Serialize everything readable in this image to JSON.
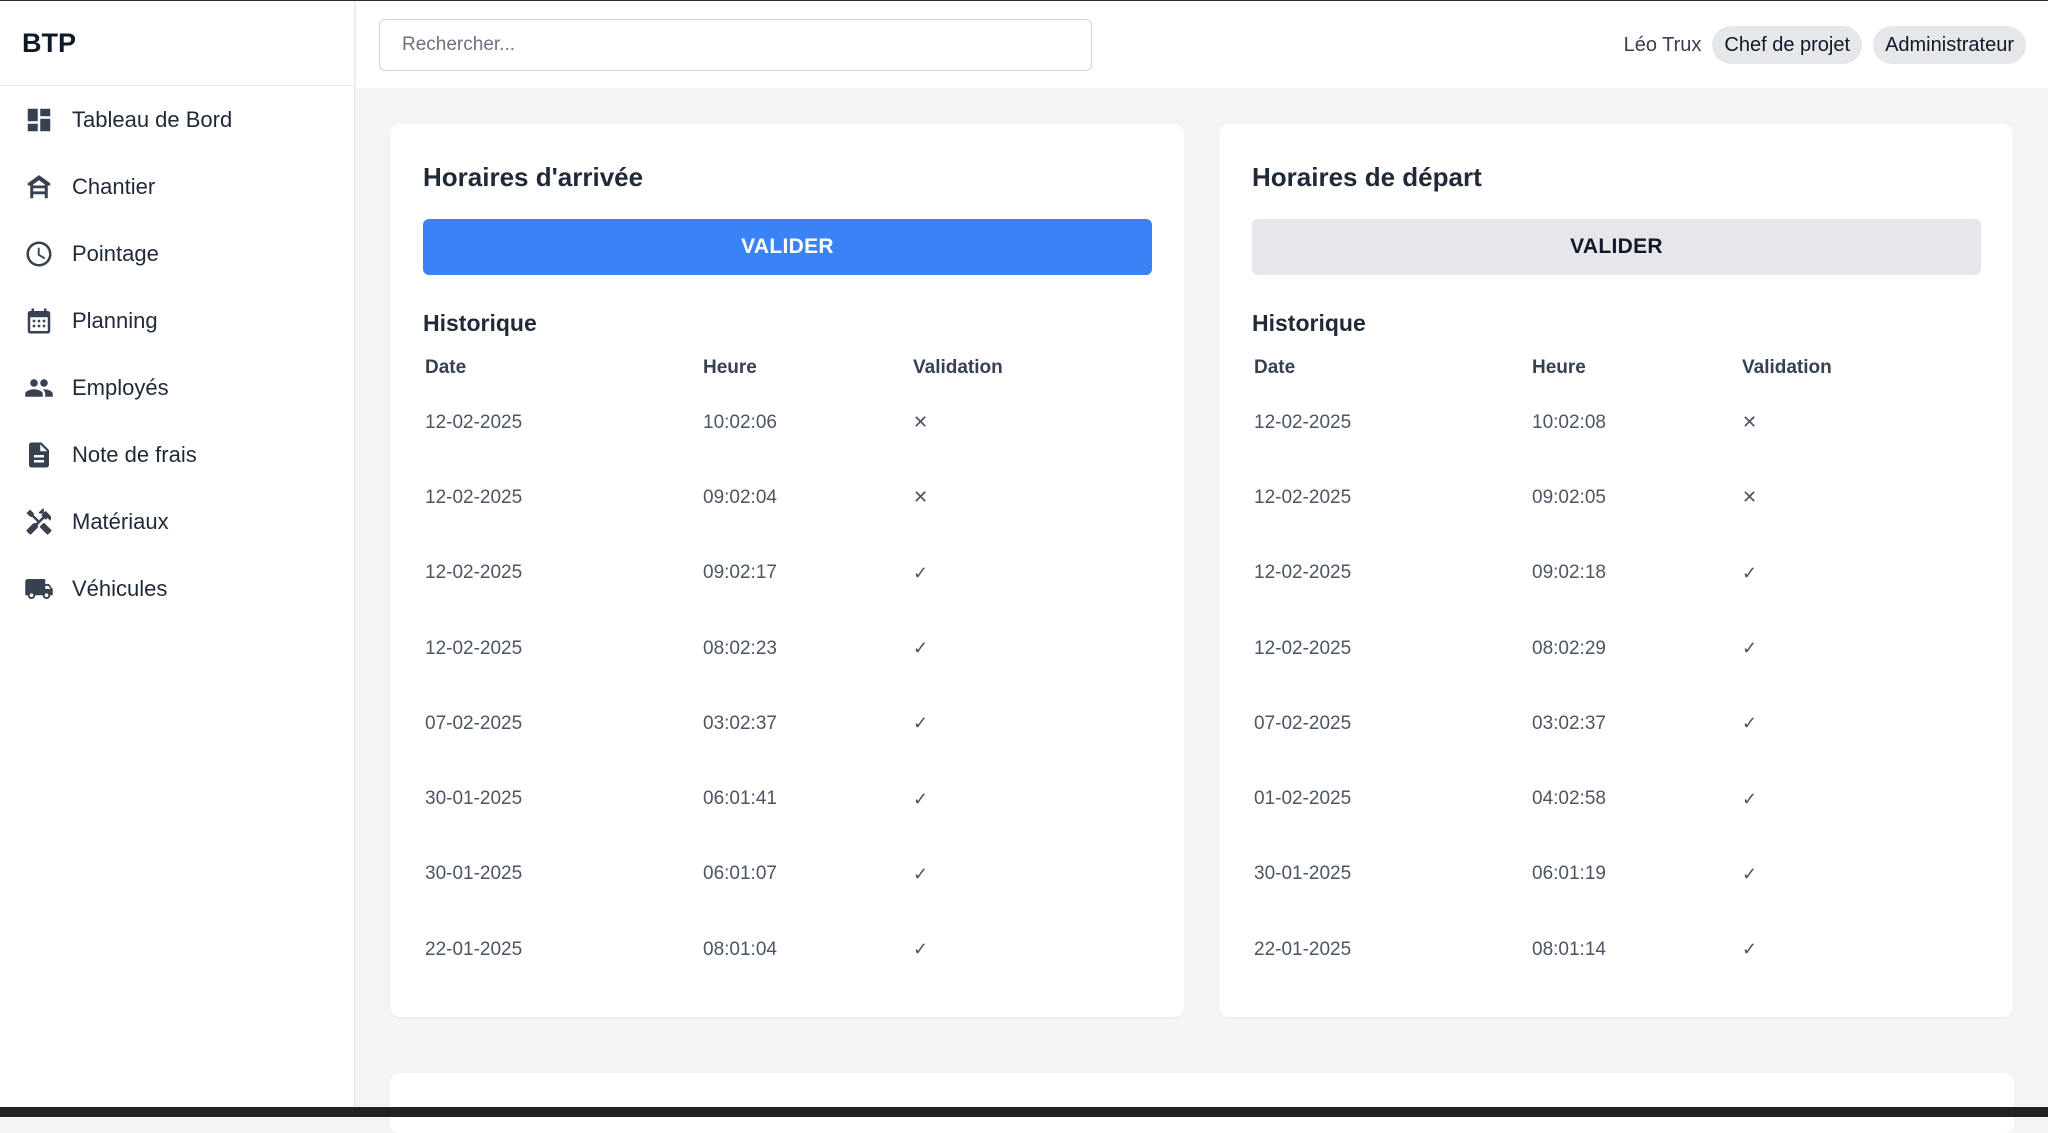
{
  "brand": "BTP",
  "sidebar": {
    "items": [
      {
        "label": "Tableau de Bord",
        "icon": "dashboard-icon"
      },
      {
        "label": "Chantier",
        "icon": "construction-icon"
      },
      {
        "label": "Pointage",
        "icon": "clock-icon"
      },
      {
        "label": "Planning",
        "icon": "calendar-icon"
      },
      {
        "label": "Employés",
        "icon": "people-icon"
      },
      {
        "label": "Note de frais",
        "icon": "document-icon"
      },
      {
        "label": "Matériaux",
        "icon": "tools-icon"
      },
      {
        "label": "Véhicules",
        "icon": "truck-icon"
      }
    ]
  },
  "header": {
    "search_placeholder": "Rechercher...",
    "user_name": "Léo Trux",
    "role1": "Chef de projet",
    "role2": "Administrateur"
  },
  "arrival": {
    "title": "Horaires d'arrivée",
    "button": "VALIDER",
    "history_title": "Historique",
    "columns": [
      "Date",
      "Heure",
      "Validation"
    ],
    "rows": [
      {
        "date": "12-02-2025",
        "time": "10:02:06",
        "validation": "✕"
      },
      {
        "date": "12-02-2025",
        "time": "09:02:04",
        "validation": "✕"
      },
      {
        "date": "12-02-2025",
        "time": "09:02:17",
        "validation": "✓"
      },
      {
        "date": "12-02-2025",
        "time": "08:02:23",
        "validation": "✓"
      },
      {
        "date": "07-02-2025",
        "time": "03:02:37",
        "validation": "✓"
      },
      {
        "date": "30-01-2025",
        "time": "06:01:41",
        "validation": "✓"
      },
      {
        "date": "30-01-2025",
        "time": "06:01:07",
        "validation": "✓"
      },
      {
        "date": "22-01-2025",
        "time": "08:01:04",
        "validation": "✓"
      }
    ]
  },
  "departure": {
    "title": "Horaires de départ",
    "button": "VALIDER",
    "history_title": "Historique",
    "columns": [
      "Date",
      "Heure",
      "Validation"
    ],
    "rows": [
      {
        "date": "12-02-2025",
        "time": "10:02:08",
        "validation": "✕"
      },
      {
        "date": "12-02-2025",
        "time": "09:02:05",
        "validation": "✕"
      },
      {
        "date": "12-02-2025",
        "time": "09:02:18",
        "validation": "✓"
      },
      {
        "date": "12-02-2025",
        "time": "08:02:29",
        "validation": "✓"
      },
      {
        "date": "07-02-2025",
        "time": "03:02:37",
        "validation": "✓"
      },
      {
        "date": "01-02-2025",
        "time": "04:02:58",
        "validation": "✓"
      },
      {
        "date": "30-01-2025",
        "time": "06:01:19",
        "validation": "✓"
      },
      {
        "date": "22-01-2025",
        "time": "08:01:14",
        "validation": "✓"
      }
    ]
  },
  "colors": {
    "primary": "#3b82f6",
    "secondary_button": "#e5e7eb",
    "background": "#f3f4f6"
  }
}
